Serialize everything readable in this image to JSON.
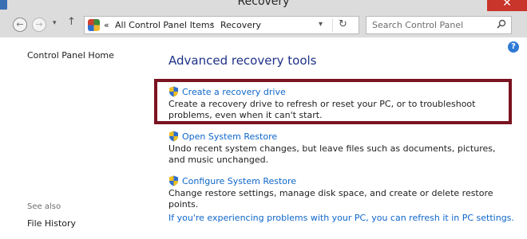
{
  "window": {
    "title": "Recovery",
    "close_glyph": "✕"
  },
  "nav": {
    "back_glyph": "←",
    "forward_glyph": "→",
    "recent_glyph": "▾",
    "up_glyph": "↑",
    "breadcrumb": {
      "overflow": "«",
      "items": [
        "All Control Panel Items",
        "Recovery"
      ],
      "separator": "›",
      "dropdown_glyph": "▾",
      "refresh_glyph": "↻"
    },
    "search": {
      "placeholder": "Search Control Panel"
    }
  },
  "sidebar": {
    "home": "Control Panel Home",
    "see_also_label": "See also",
    "see_also_items": [
      "File History"
    ]
  },
  "main": {
    "heading": "Advanced recovery tools",
    "help_glyph": "?",
    "tools": [
      {
        "label": "Create a recovery drive",
        "description": "Create a recovery drive to refresh or reset your PC, or to troubleshoot problems, even when it can't start.",
        "highlighted": true
      },
      {
        "label": "Open System Restore",
        "description": "Undo recent system changes, but leave files such as documents, pictures, and music unchanged."
      },
      {
        "label": "Configure System Restore",
        "description": "Change restore settings, manage disk space, and create or delete restore points."
      }
    ],
    "refresh_link": "If you're experiencing problems with your PC, you can refresh it in PC settings."
  },
  "colors": {
    "link": "#0e66c9",
    "heading": "#1e3287",
    "highlight_border": "#7b1320",
    "close_button": "#c9342b"
  }
}
